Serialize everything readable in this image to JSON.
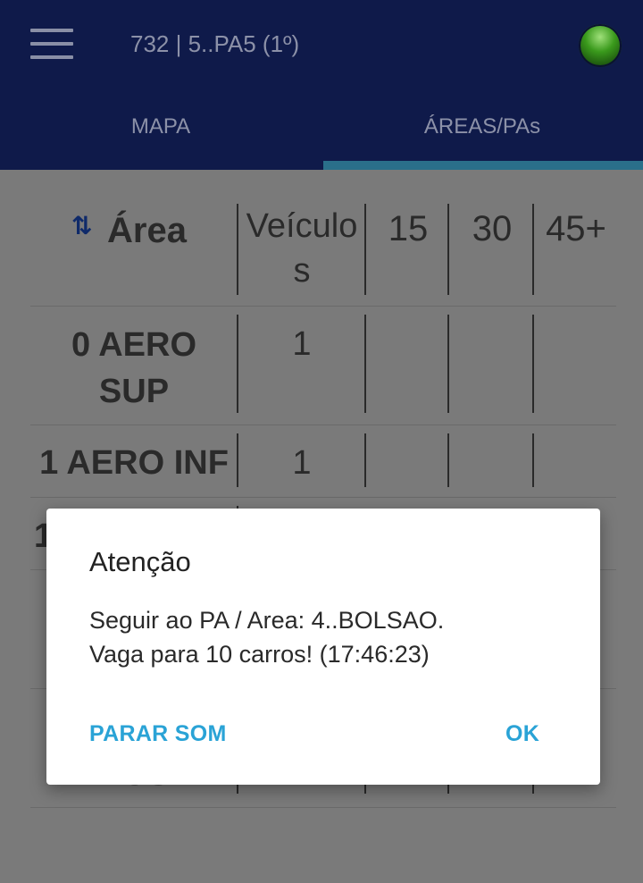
{
  "appbar": {
    "title": "732 | 5..PA5 (1º)",
    "status_color": "#3a9a1c"
  },
  "tabs": [
    {
      "label": "MAPA",
      "active": false
    },
    {
      "label": "ÁREAS/PAs",
      "active": true
    }
  ],
  "table": {
    "headers": {
      "sort_icon": "sort-arrows-icon",
      "area": "Área",
      "veiculos_line1": "Veículo",
      "veiculos_line2": "s",
      "c15": "15",
      "c30": "30",
      "c45": "45+"
    },
    "rows": [
      {
        "area_line1": "0 AERO",
        "area_line2": "SUP",
        "veiculos": "1"
      },
      {
        "area_line1": "1 AERO INF",
        "area_line2": "",
        "veiculos": "1"
      },
      {
        "area_line1": "1",
        "area_line2": "",
        "veiculos": ""
      },
      {
        "area_line1": "",
        "area_line2": "",
        "veiculos": ""
      },
      {
        "area_line1": "BUS",
        "area_line2": "",
        "veiculos": ""
      }
    ]
  },
  "dialog": {
    "title": "Atenção",
    "message_line1": "Seguir ao PA / Area: 4..BOLSAO.",
    "message_line2": "Vaga para 10 carros! (17:46:23)",
    "stop_sound": "PARAR SOM",
    "ok": "OK"
  }
}
